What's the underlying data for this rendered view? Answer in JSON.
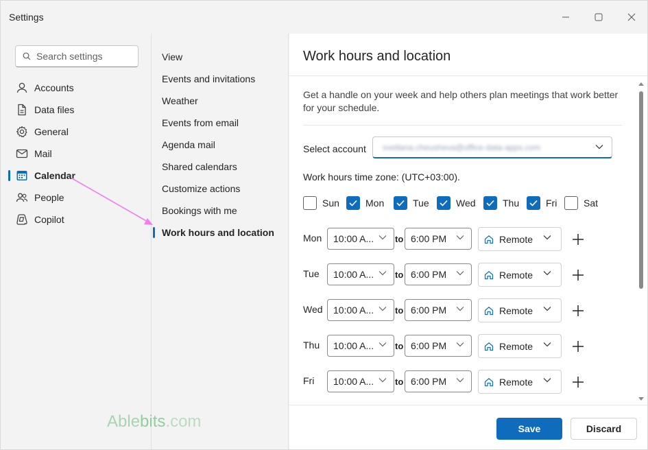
{
  "window": {
    "title": "Settings"
  },
  "search": {
    "placeholder": "Search settings"
  },
  "nav": {
    "items": [
      {
        "label": "Accounts",
        "icon": "person-icon"
      },
      {
        "label": "Data files",
        "icon": "document-icon"
      },
      {
        "label": "General",
        "icon": "gear-icon"
      },
      {
        "label": "Mail",
        "icon": "mail-icon"
      },
      {
        "label": "Calendar",
        "icon": "calendar-icon",
        "active": true
      },
      {
        "label": "People",
        "icon": "people-icon"
      },
      {
        "label": "Copilot",
        "icon": "copilot-icon"
      }
    ]
  },
  "subnav": {
    "items": [
      {
        "label": "View"
      },
      {
        "label": "Events and invitations"
      },
      {
        "label": "Weather"
      },
      {
        "label": "Events from email"
      },
      {
        "label": "Agenda mail"
      },
      {
        "label": "Shared calendars"
      },
      {
        "label": "Customize actions"
      },
      {
        "label": "Bookings with me"
      },
      {
        "label": "Work hours and location",
        "active": true
      }
    ]
  },
  "watermark": {
    "brand": "Able",
    "brand2": "bits",
    "tld": ".com"
  },
  "content": {
    "title": "Work hours and location",
    "description": "Get a handle on your week and help others plan meetings that work better for your schedule.",
    "account_label": "Select account",
    "account_value": "svetlana.cheusheva@office-data-apps.com",
    "timezone": "Work hours time zone: (UTC+03:00).",
    "days": [
      {
        "label": "Sun",
        "checked": false
      },
      {
        "label": "Mon",
        "checked": true
      },
      {
        "label": "Tue",
        "checked": true
      },
      {
        "label": "Wed",
        "checked": true
      },
      {
        "label": "Thu",
        "checked": true
      },
      {
        "label": "Fri",
        "checked": true
      },
      {
        "label": "Sat",
        "checked": false
      }
    ],
    "to_label": "to",
    "schedule": [
      {
        "day": "Mon",
        "start": "10:00 A...",
        "end": "6:00 PM",
        "location": "Remote"
      },
      {
        "day": "Tue",
        "start": "10:00 A...",
        "end": "6:00 PM",
        "location": "Remote"
      },
      {
        "day": "Wed",
        "start": "10:00 A...",
        "end": "6:00 PM",
        "location": "Remote"
      },
      {
        "day": "Thu",
        "start": "10:00 A...",
        "end": "6:00 PM",
        "location": "Remote"
      },
      {
        "day": "Fri",
        "start": "10:00 A...",
        "end": "6:00 PM",
        "location": "Remote"
      }
    ],
    "save_label": "Save",
    "discard_label": "Discard"
  },
  "colors": {
    "accent": "#0f6cbd",
    "arrow": "#f27ef0",
    "watermark": "#8fcf9c"
  }
}
